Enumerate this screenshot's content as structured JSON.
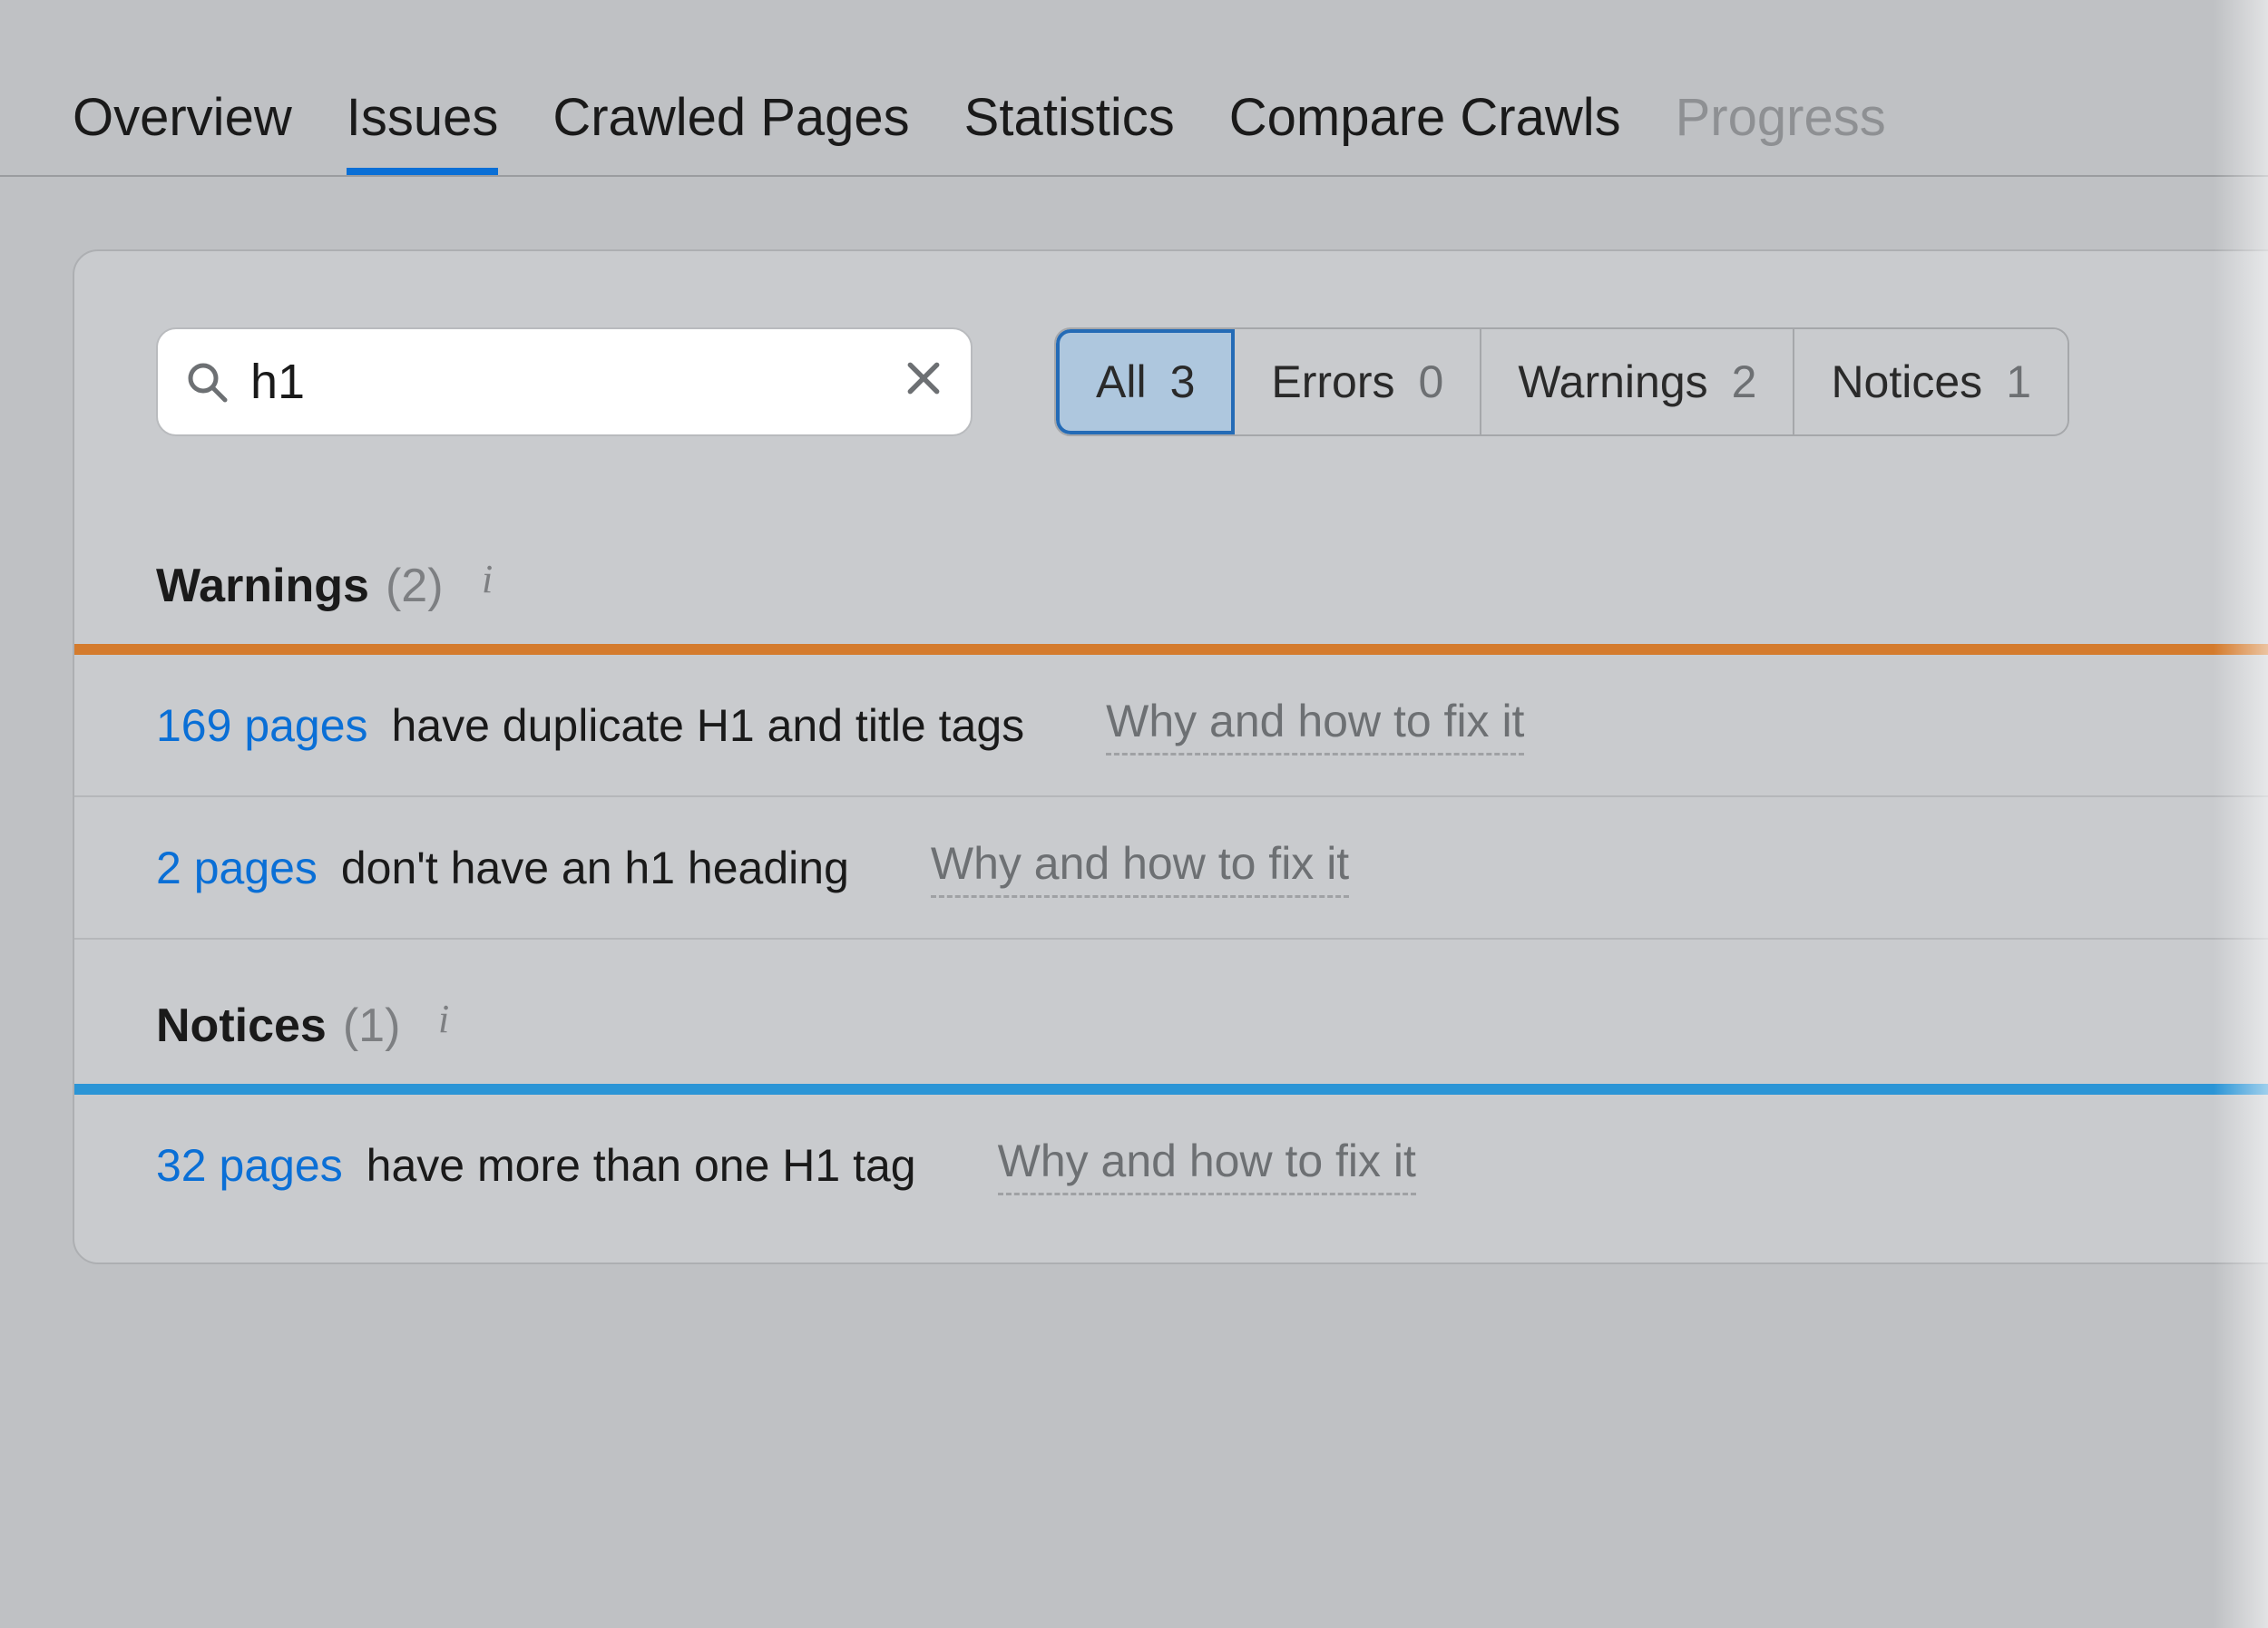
{
  "tabs": {
    "overview": "Overview",
    "issues": "Issues",
    "crawled": "Crawled Pages",
    "stats": "Statistics",
    "compare": "Compare Crawls",
    "progress": "Progress"
  },
  "search": {
    "value": "h1",
    "placeholder": ""
  },
  "filters": {
    "all_label": "All",
    "all_count": "3",
    "errors_label": "Errors",
    "errors_count": "0",
    "warnings_label": "Warnings",
    "warnings_count": "2",
    "notices_label": "Notices",
    "notices_count": "1"
  },
  "sections": {
    "warnings": {
      "title": "Warnings",
      "count_display": "(2)"
    },
    "notices": {
      "title": "Notices",
      "count_display": "(1)"
    }
  },
  "rows": {
    "w0_link": "169 pages",
    "w0_desc": "have duplicate H1 and title tags",
    "w1_link": "2 pages",
    "w1_desc": "don't have an h1 heading",
    "n0_link": "32 pages",
    "n0_desc": "have more than one H1 tag",
    "fix_label": "Why and how to fix it"
  }
}
